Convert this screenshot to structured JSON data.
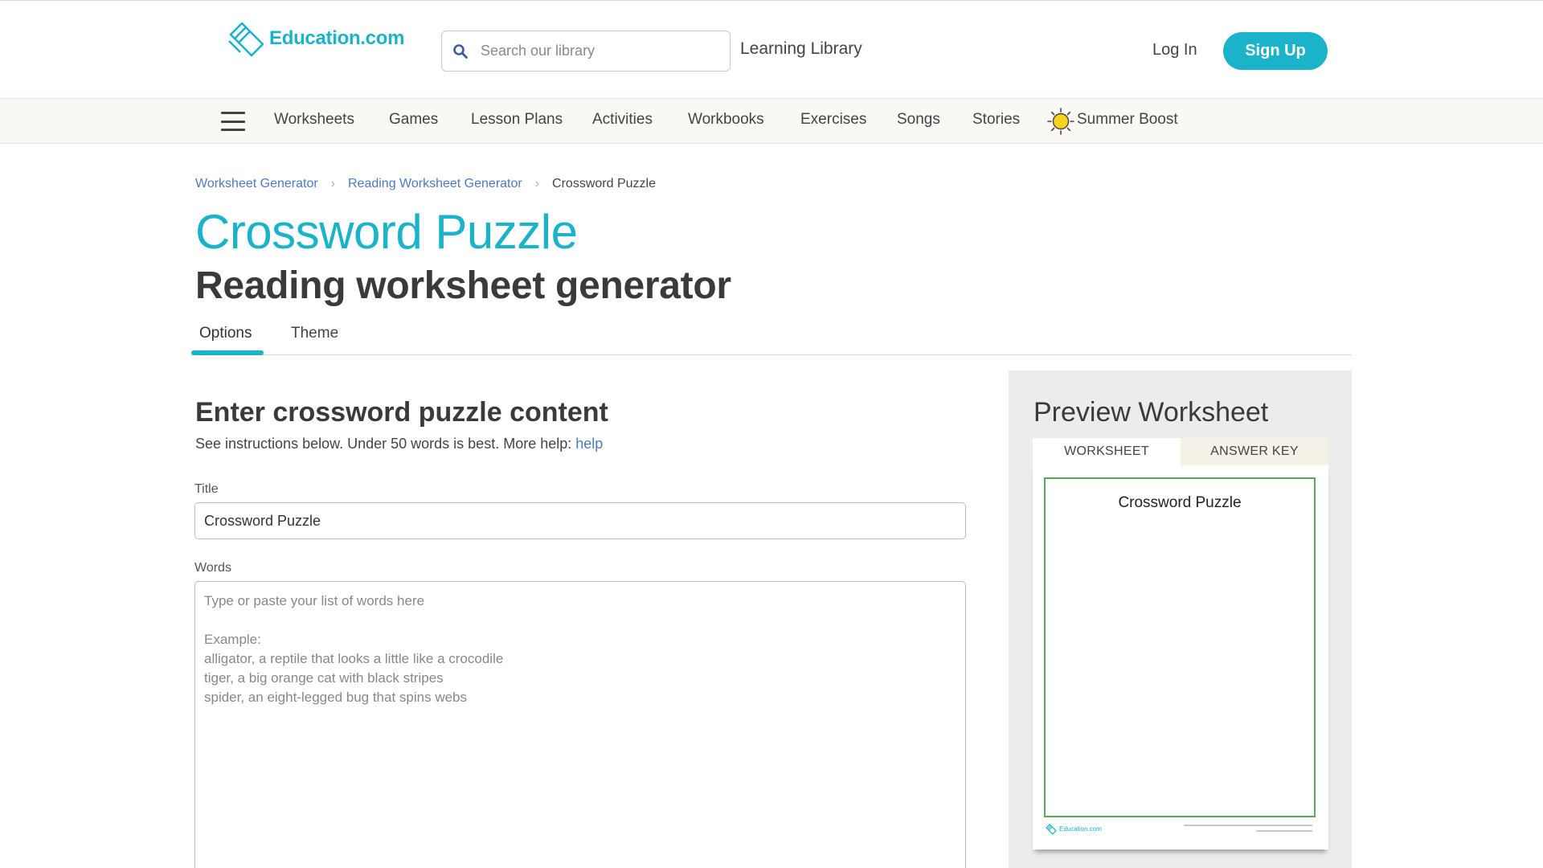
{
  "header": {
    "logo_text": "Education.com",
    "search_placeholder": "Search our library",
    "learning_library": "Learning Library",
    "login": "Log In",
    "signup": "Sign Up"
  },
  "nav": {
    "items": [
      "Worksheets",
      "Games",
      "Lesson Plans",
      "Activities",
      "Workbooks",
      "Exercises",
      "Songs",
      "Stories"
    ],
    "summer_boost": "Summer Boost"
  },
  "breadcrumb": {
    "items": [
      "Worksheet Generator",
      "Reading Worksheet Generator"
    ],
    "current": "Crossword Puzzle"
  },
  "page": {
    "title": "Crossword Puzzle",
    "subtitle": "Reading worksheet generator"
  },
  "tabs": {
    "options": "Options",
    "theme": "Theme"
  },
  "form": {
    "heading": "Enter crossword puzzle content",
    "help_text": "See instructions below. Under 50 words is best. More help:",
    "help_link": "help",
    "title_label": "Title",
    "title_value": "Crossword Puzzle",
    "words_label": "Words",
    "words_placeholder": "Type or paste your list of words here\n\nExample:\nalligator, a reptile that looks a little like a crocodile\ntiger, a big orange cat with black stripes\nspider, an eight-legged bug that spins webs"
  },
  "preview": {
    "heading": "Preview Worksheet",
    "tab_worksheet": "WORKSHEET",
    "tab_answer_key": "ANSWER KEY",
    "sheet_title": "Crossword Puzzle",
    "sheet_logo": "Education.com"
  },
  "colors": {
    "brand": "#1ab3c9",
    "link": "#4a7ac4",
    "sheet_border": "#5aa860"
  }
}
